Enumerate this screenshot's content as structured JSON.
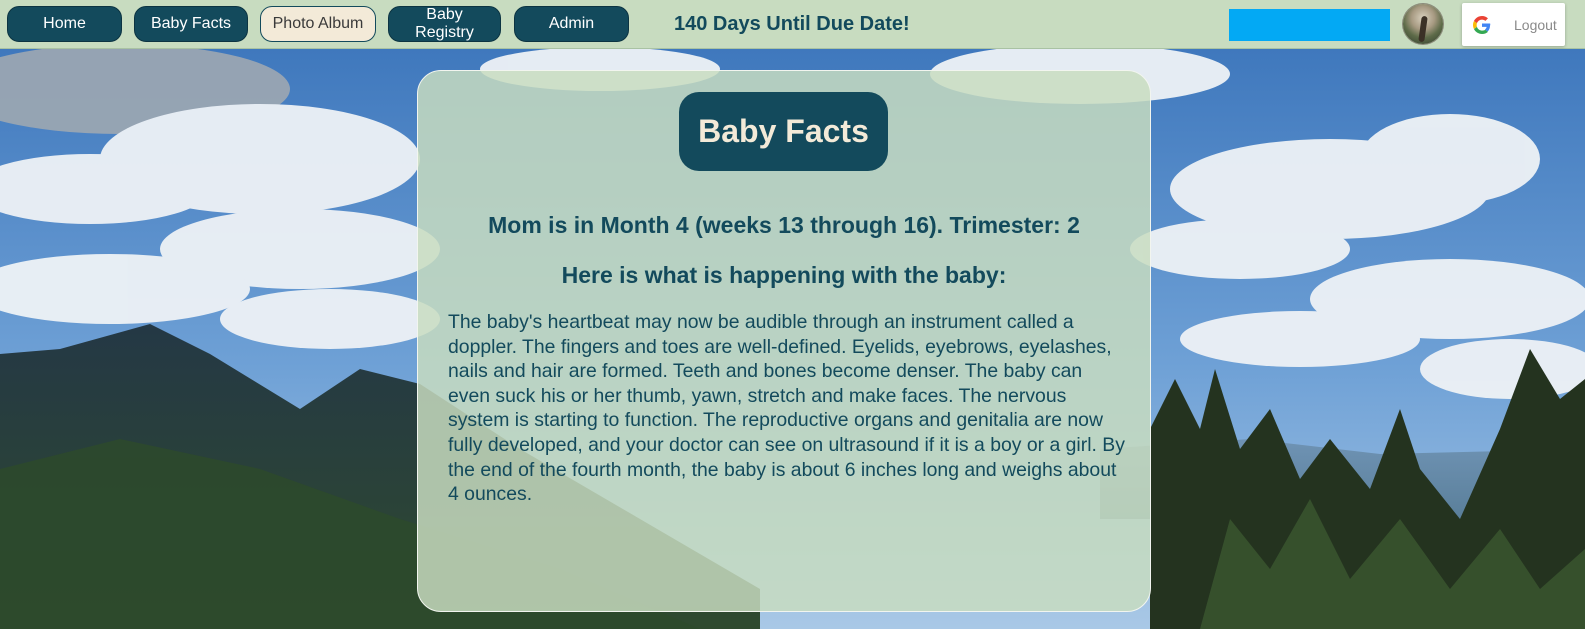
{
  "nav": {
    "home": "Home",
    "baby_facts": "Baby Facts",
    "photo_album": "Photo Album",
    "baby_registry": "Baby Registry",
    "admin": "Admin",
    "active": "photo_album"
  },
  "countdown": "140 Days Until Due Date!",
  "account": {
    "logout_label": "Logout",
    "avatar_icon": "user-avatar-photo"
  },
  "card": {
    "title": "Baby Facts",
    "month_line": "Mom is in Month 4 (weeks 13 through 16). Trimester: 2",
    "happening_line": "Here is what is happening with the baby:",
    "body": "The baby's heartbeat may now be audible through an instrument called a doppler. The fingers and toes are well-defined. Eyelids, eyebrows, eyelashes, nails and hair are formed. Teeth and bones become denser. The baby can even suck his or her thumb, yawn, stretch and make faces. The nervous system is starting to function. The reproductive organs and genitalia are now fully developed, and your doctor can see on ultrasound if it is a boy or a girl. By the end of the fourth month, the baby is about 6 inches long and weighs about 4 ounces."
  },
  "colors": {
    "accent": "#134a5c",
    "bar_background": "#c8dcc0",
    "active_button": "#f3ead8",
    "blue_box": "#03a9f4"
  }
}
